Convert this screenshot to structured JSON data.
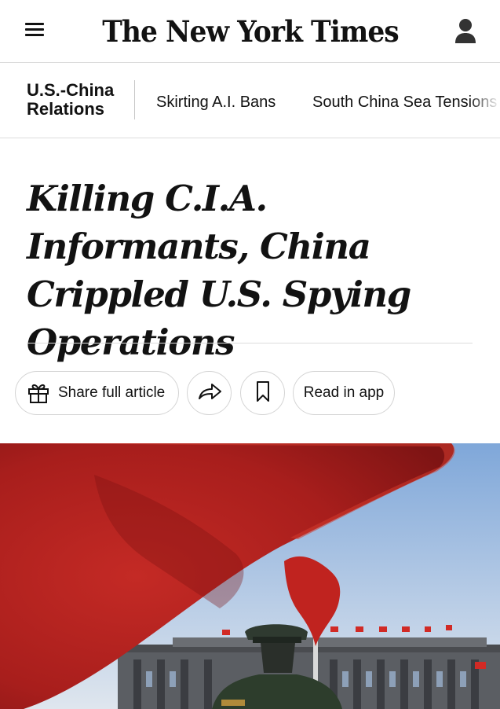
{
  "header": {
    "logo_text": "The New York Times",
    "menu_icon": "hamburger-menu-icon",
    "account_icon": "user-account-icon"
  },
  "section_nav": {
    "title": "U.S.-China Relations",
    "links": [
      {
        "label": "Skirting A.I. Bans"
      },
      {
        "label": "South China Sea Tensions"
      }
    ]
  },
  "article": {
    "headline": "Killing C.I.A. Informants, China Crippled U.S. Spying Operations"
  },
  "actions": {
    "share_full_label": "Share full article",
    "share_full_icon": "gift-icon",
    "share_icon": "share-arrow-icon",
    "save_icon": "bookmark-icon",
    "read_in_app_label": "Read in app"
  },
  "hero_image": {
    "subject": "Red Chinese flags and an honor guard soldier before the Great Hall of the People",
    "colors": {
      "flag_red": "#b0201f",
      "sky_blue": "#8fb4df"
    }
  }
}
